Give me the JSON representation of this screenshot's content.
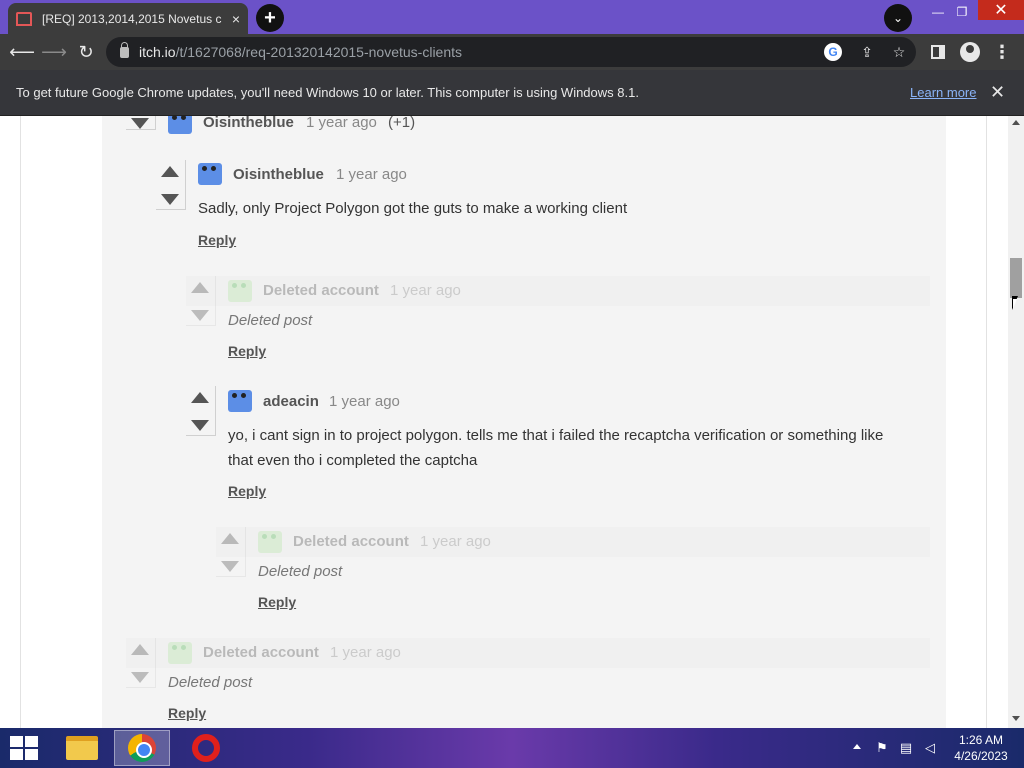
{
  "browser": {
    "tab_title": "[REQ] 2013,2014,2015 Novetus c",
    "tab_close": "×",
    "new_tab": "+",
    "tab_search": "⌄",
    "url_host": "itch.io",
    "url_path": "/t/1627068/req-201320142015-novetus-clients",
    "window_min": "—",
    "window_max": "❐",
    "window_close": "✕"
  },
  "infobar": {
    "message": "To get future Google Chrome updates, you'll need Windows 10 or later. This computer is using Windows 8.1.",
    "link": "Learn more",
    "close": "✕"
  },
  "comments": {
    "top": {
      "author": "Oisintheblue",
      "time": "1 year ago",
      "extra": "(+1)"
    },
    "c1": {
      "author": "Oisintheblue",
      "time": "1 year ago",
      "body": "Sadly, only Project Polygon got the guts to make a working client",
      "reply": "Reply"
    },
    "c2": {
      "author": "Deleted account",
      "time": "1 year ago",
      "body": "Deleted post",
      "reply": "Reply"
    },
    "c3": {
      "author": "adeacin",
      "time": "1 year ago",
      "body_line1": "yo, i cant sign in to project polygon. tells me that i failed the recaptcha verification or something like",
      "body_line2": "that even tho i completed the captcha",
      "reply": "Reply"
    },
    "c4": {
      "author": "Deleted account",
      "time": "1 year ago",
      "body": "Deleted post",
      "reply": "Reply"
    },
    "c5": {
      "author": "Deleted account",
      "time": "1 year ago",
      "body": "Deleted post",
      "reply": "Reply"
    }
  },
  "taskbar": {
    "time": "1:26 AM",
    "date": "4/26/2023"
  }
}
